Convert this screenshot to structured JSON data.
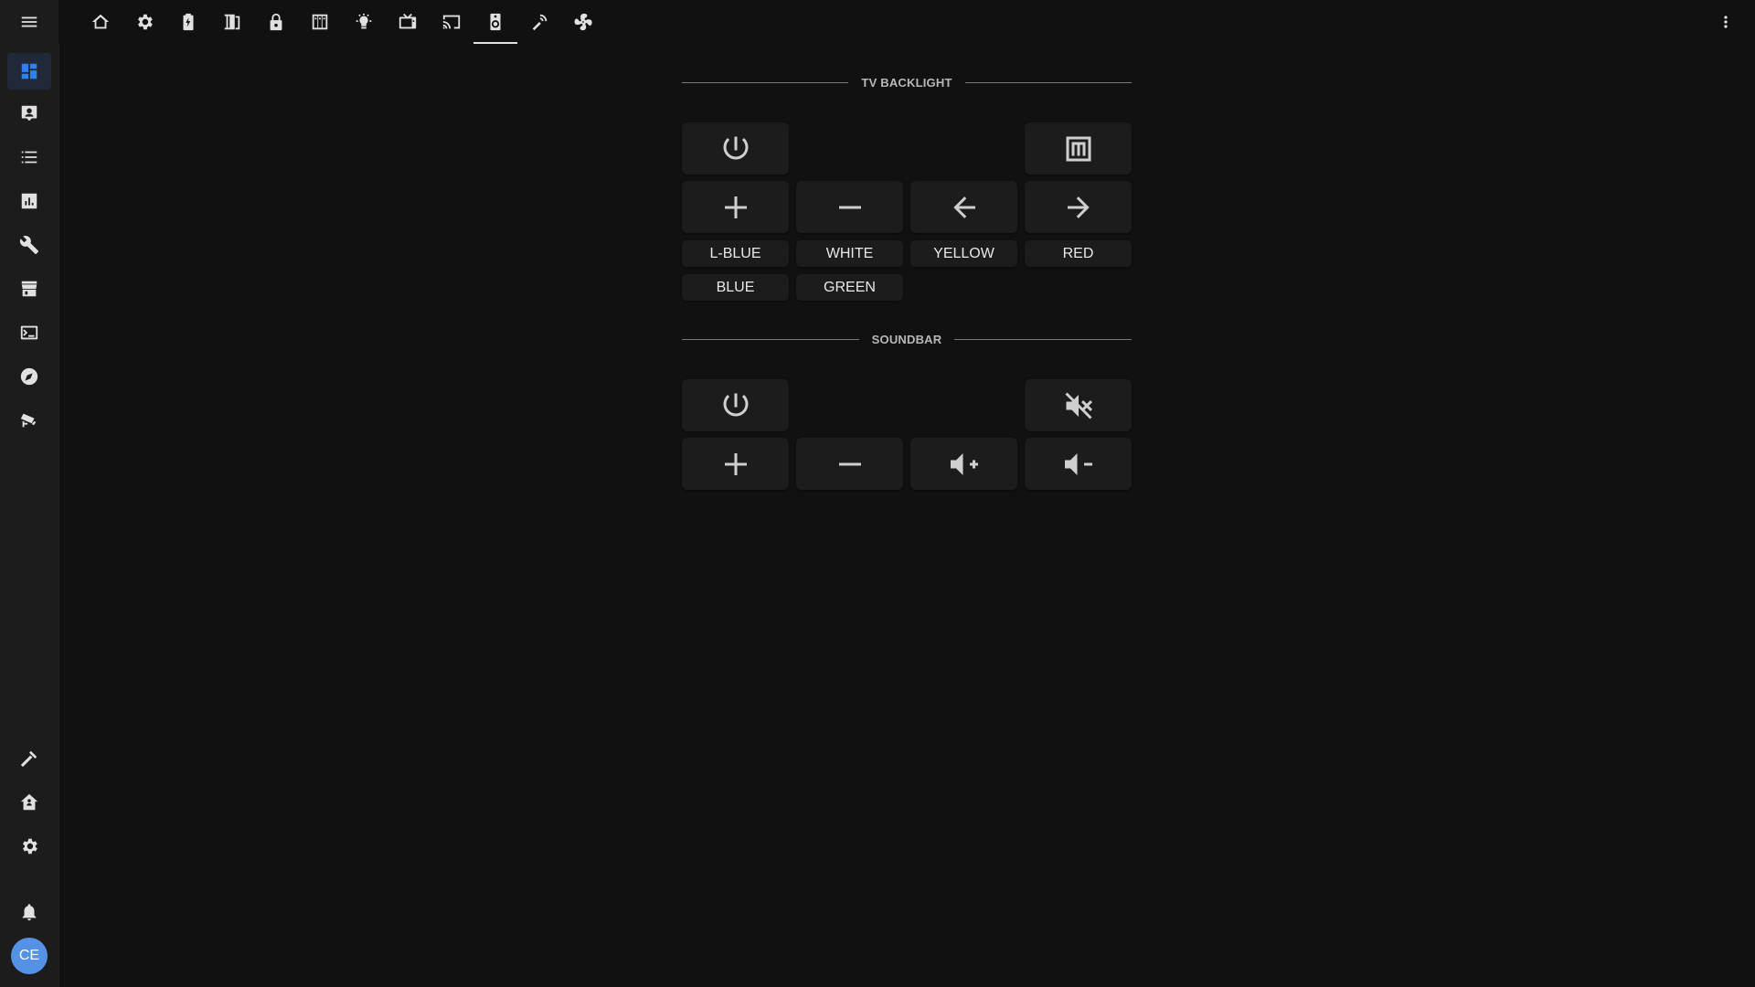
{
  "sidebar": {
    "items": [
      {
        "icon": "dashboard-icon"
      },
      {
        "icon": "map-person-icon"
      },
      {
        "icon": "logbook-list-icon"
      },
      {
        "icon": "history-chart-icon"
      },
      {
        "icon": "wrench-icon"
      },
      {
        "icon": "hacs-store-icon"
      },
      {
        "icon": "terminal-icon"
      },
      {
        "icon": "compass-icon"
      },
      {
        "icon": "cctv-icon"
      }
    ],
    "bottom_items": [
      {
        "icon": "hammer-icon"
      },
      {
        "icon": "home-assistant-icon"
      },
      {
        "icon": "gear-icon"
      }
    ],
    "notifications_icon": "bell-icon",
    "avatar_initials": "CE",
    "accent_color": "#2f7ff0"
  },
  "tabs": [
    {
      "icon": "home-outline-icon"
    },
    {
      "icon": "gear-icon"
    },
    {
      "icon": "battery-charging-icon"
    },
    {
      "icon": "door-open-icon"
    },
    {
      "icon": "lock-icon"
    },
    {
      "icon": "window-shutter-icon"
    },
    {
      "icon": "lightbulb-icon"
    },
    {
      "icon": "television-icon"
    },
    {
      "icon": "cast-icon"
    },
    {
      "icon": "speaker-icon",
      "active": true
    },
    {
      "icon": "remote-signal-icon"
    },
    {
      "icon": "fan-icon"
    }
  ],
  "tv_backlight": {
    "title": "TV BACKLIGHT",
    "colors": [
      "L-BLUE",
      "WHITE",
      "YELLOW",
      "RED",
      "BLUE",
      "GREEN"
    ]
  },
  "soundbar": {
    "title": "SOUNDBAR"
  }
}
